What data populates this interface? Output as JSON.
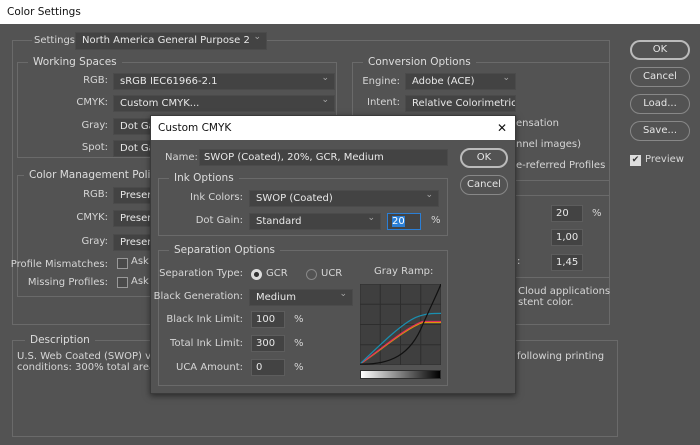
{
  "window": {
    "title": "Color Settings",
    "close": "✕"
  },
  "settings": {
    "label": "Settings:",
    "value": "North America General Purpose 2"
  },
  "working_spaces": {
    "title": "Working Spaces",
    "rgb_label": "RGB:",
    "rgb": "sRGB IEC61966-2.1",
    "cmyk_label": "CMYK:",
    "cmyk": "Custom CMYK...",
    "gray_label": "Gray:",
    "gray": "Dot Ga",
    "spot_label": "Spot:",
    "spot": "Dot Ga"
  },
  "policies": {
    "title": "Color Management Policies",
    "rgb_label": "RGB:",
    "rgb": "Preser",
    "cmyk_label": "CMYK:",
    "cmyk": "Preser",
    "gray_label": "Gray:",
    "gray": "Preser",
    "mismatch_label": "Profile Mismatches:",
    "mismatch": "Ask",
    "missing_label": "Missing Profiles:",
    "missing": "Ask"
  },
  "conversion": {
    "title": "Conversion Options",
    "engine_label": "Engine:",
    "engine": "Adobe (ACE)",
    "intent_label": "Intent:",
    "intent": "Relative Colorimetric",
    "opt1": "ensation",
    "opt2": "nnel images)",
    "opt3": "e-referred Profiles"
  },
  "advanced": {
    "v1": "20",
    "v1_unit": "%",
    "v2": "1,00",
    "v3_label": ":",
    "v3": "1,45",
    "text1": "Cloud applications",
    "text2": "stent color."
  },
  "description": {
    "title": "Description",
    "line1": "U.S. Web Coated (SWOP) v2:  U",
    "line1_end": "following printing",
    "line2": "conditions: 300% total area of"
  },
  "buttons": {
    "ok": "OK",
    "cancel": "Cancel",
    "load": "Load...",
    "save": "Save...",
    "preview": "Preview",
    "preview_checked": true
  },
  "cmyk_dialog": {
    "title": "Custom CMYK",
    "close": "✕",
    "name_label": "Name:",
    "name": "SWOP (Coated), 20%, GCR, Medium",
    "ok": "OK",
    "cancel": "Cancel",
    "ink_options": {
      "title": "Ink Options",
      "ink_colors_label": "Ink Colors:",
      "ink_colors": "SWOP (Coated)",
      "dot_gain_label": "Dot Gain:",
      "dot_gain": "Standard",
      "dot_gain_value": "20",
      "unit": "%"
    },
    "separation": {
      "title": "Separation Options",
      "type_label": "Separation Type:",
      "gcr": "GCR",
      "ucr": "UCR",
      "selected": "GCR",
      "black_gen_label": "Black Generation:",
      "black_gen": "Medium",
      "black_limit_label": "Black Ink Limit:",
      "black_limit": "100",
      "total_limit_label": "Total Ink Limit:",
      "total_limit": "300",
      "uca_label": "UCA Amount:",
      "uca": "0",
      "unit": "%",
      "gray_ramp_label": "Gray Ramp:",
      "curve_colors": {
        "cyan": "#1a8fb0",
        "magenta": "#e0305a",
        "yellow": "#d9a400",
        "black": "#111111"
      }
    }
  }
}
